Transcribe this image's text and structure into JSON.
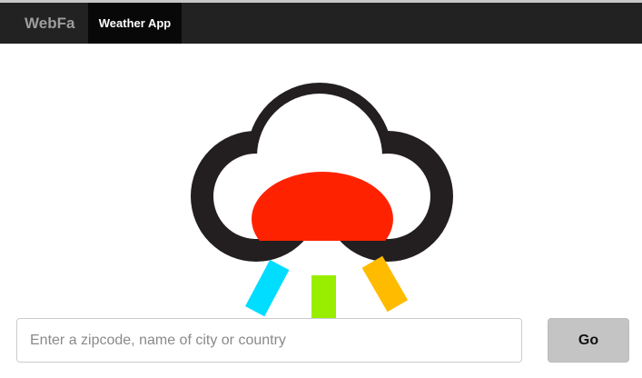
{
  "navbar": {
    "brand": "WebFa",
    "active_tab": "Weather App"
  },
  "logo": {
    "icon": "cloud-rainbow-rain-icon",
    "colors": {
      "cloud_outline": "#231f20",
      "cloud_fill": "#ffffff",
      "half_sun": "#ff2200",
      "ray_cyan": "#00ddff",
      "ray_green": "#99ee00",
      "ray_orange": "#ffbb00"
    }
  },
  "search": {
    "placeholder": "Enter a zipcode, name of city or country",
    "value": "",
    "button_label": "Go"
  },
  "colors": {
    "navbar_bg": "#222222",
    "active_tab_bg": "#080808",
    "button_bg": "#c4c4c4"
  }
}
